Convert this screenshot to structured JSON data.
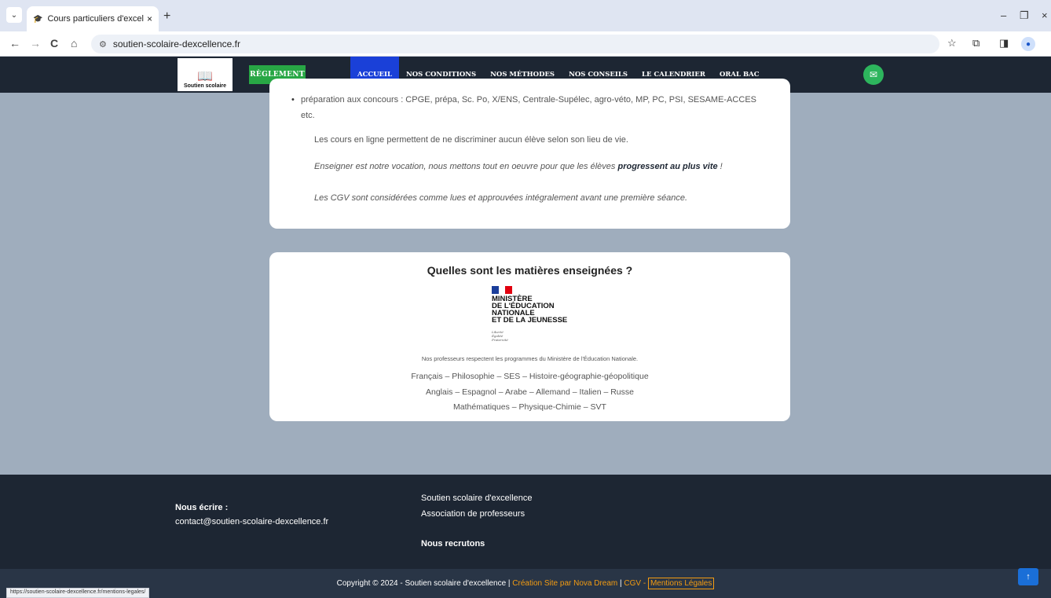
{
  "browser": {
    "tab_title": "Cours particuliers d'excellence",
    "url": "soutien-scolaire-dexcellence.fr",
    "status_url": "https://soutien-scolaire-dexcellence.fr/mentions-legales/",
    "icons": {
      "back": "←",
      "forward": "→",
      "reload": "C",
      "home": "⌂",
      "star": "☆",
      "extensions": "⧉",
      "sidepanel": "◨",
      "newtab": "+",
      "close": "×",
      "minimize": "–",
      "restore": "❐",
      "tablist": "⌄"
    }
  },
  "header": {
    "logo_text": "Soutien scolaire",
    "reglement_label": "RÈGLEMENT",
    "nav": [
      "ACCUEIL",
      "NOS CONDITIONS",
      "NOS MÉTHODES",
      "NOS CONSEILS",
      "LE CALENDRIER",
      "ORAL BAC"
    ],
    "active_nav": "ACCUEIL"
  },
  "card1": {
    "bullet": "préparation aux concours : CPGE, prépa, Sc. Po, X/ENS, Centrale-Supélec, agro-véto, MP, PC, PSI, SESAME-ACCES etc.",
    "p1": "Les cours en ligne permettent de ne discriminer aucun élève selon son lieu de vie.",
    "p2_pre": "Enseigner est notre vocation, nous mettons tout en oeuvre pour que les élèves ",
    "p2_bold": "progressent au plus vite",
    "p2_post": " !",
    "p3": "Les CGV sont considérées comme lues et approuvées intégralement avant une première séance."
  },
  "card2": {
    "title": "Quelles sont les matières enseignées ?",
    "ministry_lines": [
      "MINISTÈRE",
      "DE L'ÉDUCATION",
      "NATIONALE",
      "ET DE LA JEUNESSE"
    ],
    "devise": [
      "Liberté",
      "Égalité",
      "Fraternité"
    ],
    "note": "Nos professeurs respectent les programmes du Ministère de l'Éducation Nationale.",
    "subjects": [
      "Français – Philosophie – SES – Histoire-géographie-géopolitique",
      "Anglais – Espagnol – Arabe – Allemand – Italien – Russe",
      "Mathématiques – Physique-Chimie – SVT"
    ]
  },
  "footer": {
    "contact_label": "Nous écrire :",
    "email": "contact@soutien-scolaire-dexcellence.fr",
    "col2_line1": "Soutien scolaire d'excellence",
    "col2_line2": "Association de professeurs",
    "recruit": "Nous recrutons"
  },
  "bottom": {
    "copyright": "Copyright © 2024 - Soutien scolaire d'excellence | ",
    "creation": "Création Site par Nova Dream",
    "sep": " | ",
    "cgv": "CGV",
    "dash": " - ",
    "mentions": "Mentions Légales"
  },
  "colors": {
    "header_bg": "#1d2633",
    "active_nav": "#1a40d8",
    "reglement": "#28a745",
    "accent_orange": "#f39c12"
  }
}
